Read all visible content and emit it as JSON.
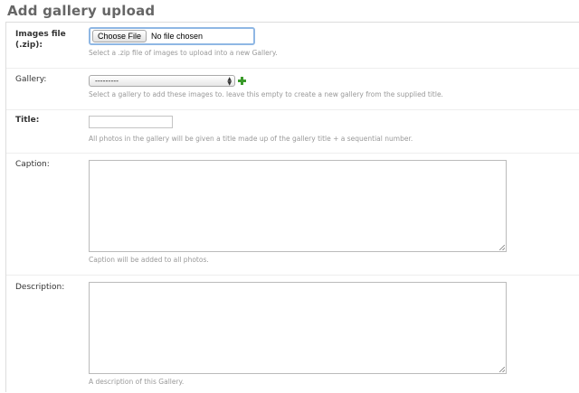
{
  "page": {
    "title": "Add gallery upload"
  },
  "fields": {
    "images_file": {
      "label_line1": "Images file",
      "label_line2": "(.zip):",
      "choose_button": "Choose File",
      "status": "No file chosen",
      "help": "Select a .zip file of images to upload into a new Gallery."
    },
    "gallery": {
      "label": "Gallery:",
      "selected": "---------",
      "help": "Select a gallery to add these images to. leave this empty to create a new gallery from the supplied title."
    },
    "title": {
      "label": "Title:",
      "value": "",
      "help": "All photos in the gallery will be given a title made up of the gallery title + a sequential number."
    },
    "caption": {
      "label": "Caption:",
      "value": "",
      "help": "Caption will be added to all photos."
    },
    "description": {
      "label": "Description:",
      "value": "",
      "help": "A description of this Gallery."
    }
  },
  "colors": {
    "add_icon": "#3a9a2a",
    "focus_border": "#8fb7e4"
  }
}
